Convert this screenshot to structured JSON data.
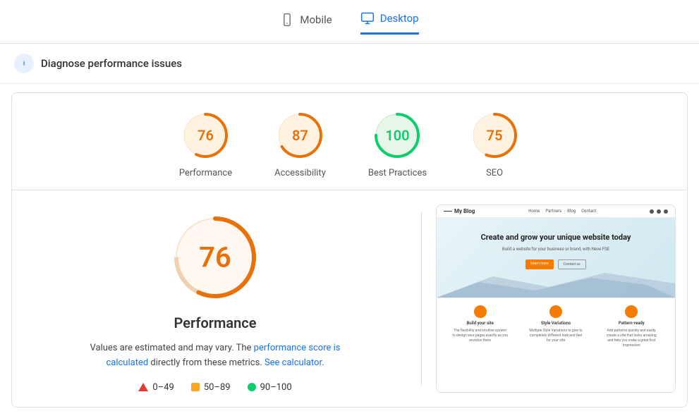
{
  "header": {
    "tabs": [
      {
        "id": "mobile",
        "label": "Mobile",
        "active": false
      },
      {
        "id": "desktop",
        "label": "Desktop",
        "active": true
      }
    ]
  },
  "diagnose": {
    "title": "Diagnose performance issues"
  },
  "scores": [
    {
      "id": "performance",
      "value": "76",
      "label": "Performance",
      "color": "#e8710a",
      "stroke": "#e8710a",
      "bg": "#fff3e0",
      "pct": 76
    },
    {
      "id": "accessibility",
      "value": "87",
      "label": "Accessibility",
      "color": "#e8710a",
      "stroke": "#e8710a",
      "bg": "#fff3e0",
      "pct": 87
    },
    {
      "id": "best-practices",
      "value": "100",
      "label": "Best Practices",
      "color": "#0cce6b",
      "stroke": "#0cce6b",
      "bg": "#e8f5e9",
      "pct": 100
    },
    {
      "id": "seo",
      "value": "75",
      "label": "SEO",
      "color": "#e8710a",
      "stroke": "#e8710a",
      "bg": "#fff3e0",
      "pct": 75
    }
  ],
  "large_score": {
    "value": "76",
    "title": "Performance",
    "pct": 76
  },
  "description": {
    "text_before": "Values are estimated and may vary. The ",
    "link1_text": "performance score is calculated",
    "text_middle": " directly from these metrics. ",
    "link2_text": "See calculator",
    "text_after": "."
  },
  "legend": [
    {
      "id": "low",
      "range": "0–49",
      "type": "triangle",
      "color": "#e53935"
    },
    {
      "id": "mid",
      "range": "50–89",
      "type": "square",
      "color": "#f9a825"
    },
    {
      "id": "high",
      "range": "90–100",
      "type": "circle",
      "color": "#0cce6b"
    }
  ],
  "preview": {
    "site_name": "My Blog",
    "nav_links": [
      "Home",
      "Partners",
      "Blog",
      "Contact"
    ],
    "hero_title": "Create and grow your unique website today",
    "hero_sub": "Build a website for your business or brand, with Neve FSE",
    "btn_learn": "Learn more",
    "btn_contact": "Contact us",
    "features": [
      {
        "title": "Build your site",
        "desc": "The flexibility and intuitive system to design your pages exactly as you envision them"
      },
      {
        "title": "Style Variations",
        "desc": "Multiple Style Variations to give to completely different look and feel for your site"
      },
      {
        "title": "Pattern-ready",
        "desc": "Add patterns quickly and easily, create a site that looks amazing and help you make a great first impression"
      }
    ]
  }
}
